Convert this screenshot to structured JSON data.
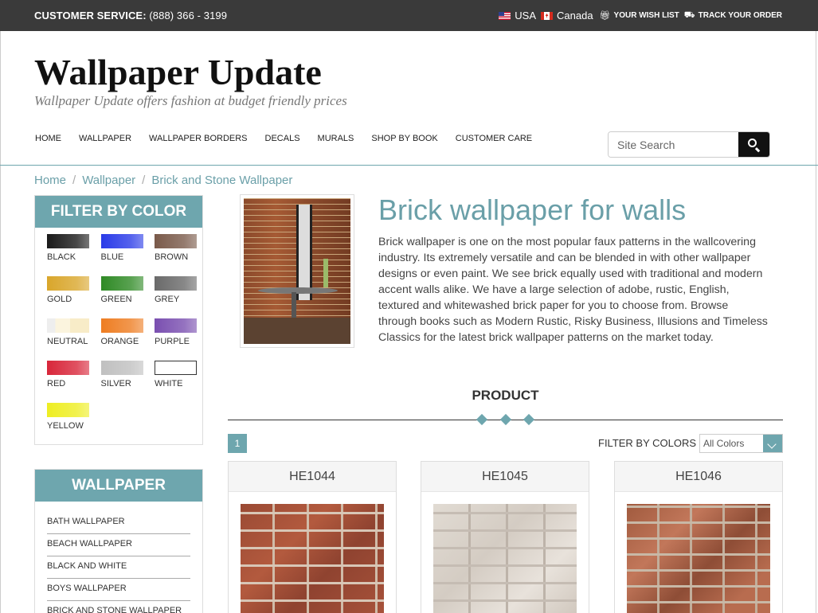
{
  "topbar": {
    "customer_service_label": "CUSTOMER SERVICE:",
    "phone": "(888) 366 - 3199",
    "usa": "USA",
    "canada": "Canada",
    "wish_list": "YOUR WISH LIST",
    "track_order": "TRACK YOUR ORDER"
  },
  "header": {
    "logo": "Wallpaper Update",
    "tagline": "Wallpaper Update offers fashion at budget friendly prices"
  },
  "nav": [
    "HOME",
    "WALLPAPER",
    "WALLPAPER BORDERS",
    "DECALS",
    "MURALS",
    "SHOP BY BOOK",
    "CUSTOMER CARE"
  ],
  "search": {
    "placeholder": "Site Search"
  },
  "breadcrumb": [
    "Home",
    "Wallpaper",
    "Brick and Stone Wallpaper"
  ],
  "filter_by_color": {
    "title": "FILTER BY COLOR",
    "colors": [
      {
        "label": "BLACK",
        "color": "#1a1a1a"
      },
      {
        "label": "BLUE",
        "color": "#2a3be8"
      },
      {
        "label": "BROWN",
        "color": "#7a5a4a"
      },
      {
        "label": "GOLD",
        "color": "#d9a62b"
      },
      {
        "label": "GREEN",
        "color": "#2f8a25"
      },
      {
        "label": "GREY",
        "color": "#6a6a6a"
      },
      {
        "label": "NEUTRAL",
        "color": "#f5ead0"
      },
      {
        "label": "ORANGE",
        "color": "#ee7d22"
      },
      {
        "label": "PURPLE",
        "color": "#7a4fb0"
      },
      {
        "label": "RED",
        "color": "#d8263a"
      },
      {
        "label": "SILVER",
        "color": "#c0c0c0"
      },
      {
        "label": "WHITE",
        "color": "#ffffff"
      },
      {
        "label": "YELLOW",
        "color": "#eeee22"
      }
    ]
  },
  "wallpaper_panel": {
    "title": "WALLPAPER",
    "items": [
      "BATH WALLPAPER",
      "BEACH WALLPAPER",
      "BLACK AND WHITE",
      "BOYS WALLPAPER",
      "BRICK AND STONE WALLPAPER"
    ]
  },
  "main": {
    "heading": "Brick wallpaper for walls",
    "description": "Brick wallpaper is one on the most popular faux patterns in the wallcovering industry. Its extremely versatile and can be blended in with other wallpaper designs or even paint.  We see brick equally used with traditional and modern accent walls alike.  We have a large selection of adobe, rustic, English, textured and whitewashed brick paper for you to choose from.  Browse through books such as Modern Rustic, Risky Business, Illusions and Timeless Classics for the latest brick wallpaper patterns on the market today."
  },
  "products": {
    "heading": "PRODUCT",
    "page": "1",
    "filter_label": "FILTER BY COLORS",
    "filter_value": "All Colors",
    "items": [
      "HE1044",
      "HE1045",
      "HE1046"
    ]
  }
}
